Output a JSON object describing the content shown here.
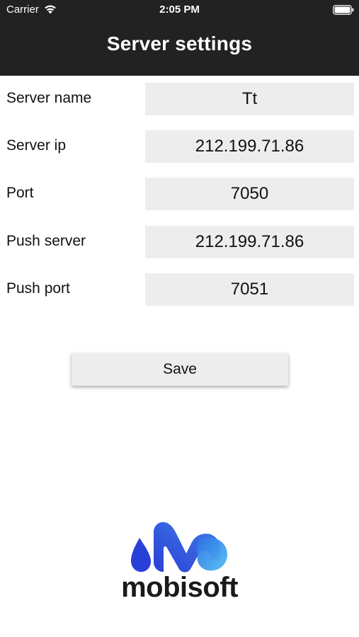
{
  "status_bar": {
    "carrier": "Carrier",
    "time": "2:05 PM",
    "icons": [
      "wifi-icon",
      "battery-icon"
    ]
  },
  "header": {
    "title": "Server settings",
    "background_color": "#222222",
    "text_color": "#ffffff"
  },
  "form": {
    "fields": [
      {
        "label": "Server name",
        "value": "Tt"
      },
      {
        "label": "Server ip",
        "value": "212.199.71.86"
      },
      {
        "label": "Port",
        "value": "7050"
      },
      {
        "label": "Push server",
        "value": "212.199.71.86"
      },
      {
        "label": "Push port",
        "value": "7051"
      }
    ],
    "field_background": "#ededed"
  },
  "actions": {
    "save_label": "Save"
  },
  "branding": {
    "logo_text": "mobisoft",
    "logo_colors": [
      "#2b4bdc",
      "#3b8fe6",
      "#4fc3f0"
    ]
  }
}
